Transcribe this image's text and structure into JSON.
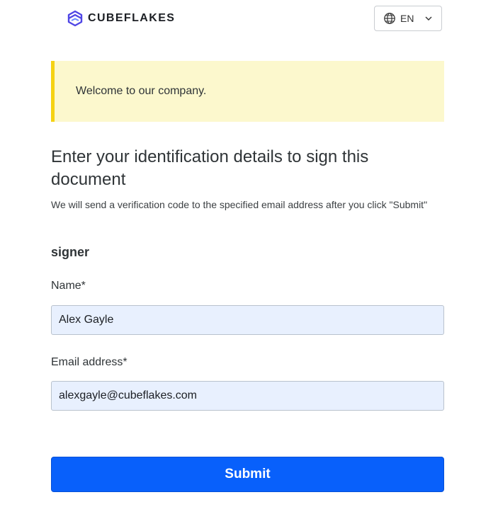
{
  "header": {
    "brand_name": "CUBEFLAKES",
    "logo_icon": "cube-logo-icon",
    "language": {
      "code": "EN",
      "globe_icon": "globe-icon",
      "chevron_icon": "chevron-down-icon"
    }
  },
  "banner": {
    "message": "Welcome to our company."
  },
  "form": {
    "title": "Enter your identification details to sign this document",
    "subtitle": "We will send a verification code to the specified email address after you click \"Submit\"",
    "section_label": "signer",
    "name": {
      "label": "Name*",
      "value": "Alex Gayle"
    },
    "email": {
      "label": "Email address*",
      "value": "alexgayle@cubeflakes.com"
    },
    "submit_label": "Submit"
  },
  "colors": {
    "banner_bg": "#fcf8cd",
    "banner_accent": "#f5d213",
    "input_bg": "#e8f0fe",
    "primary": "#0860fb",
    "logo_blue": "#4f46e5"
  }
}
